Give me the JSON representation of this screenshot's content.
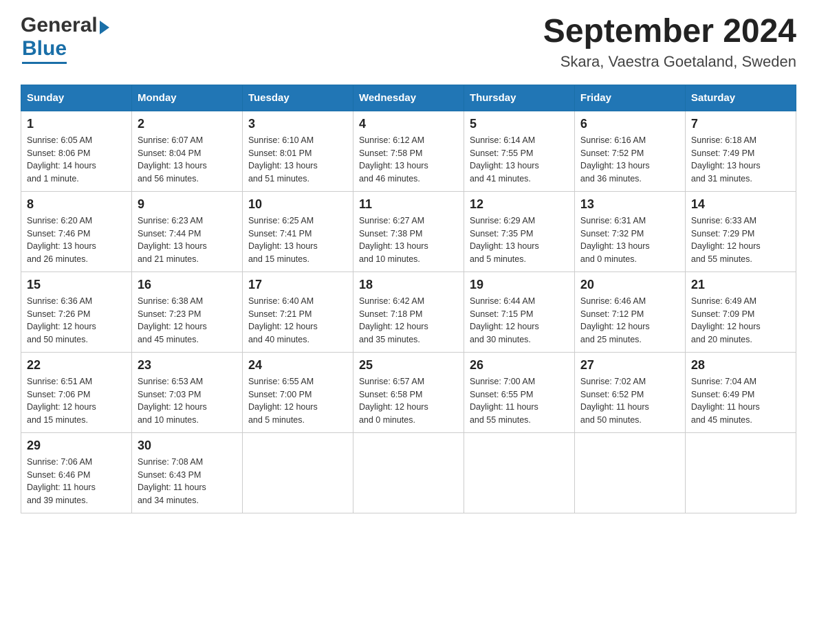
{
  "header": {
    "logo_general": "General",
    "logo_blue": "Blue",
    "month_year": "September 2024",
    "location": "Skara, Vaestra Goetaland, Sweden"
  },
  "weekdays": [
    "Sunday",
    "Monday",
    "Tuesday",
    "Wednesday",
    "Thursday",
    "Friday",
    "Saturday"
  ],
  "weeks": [
    [
      {
        "day": "1",
        "sunrise": "6:05 AM",
        "sunset": "8:06 PM",
        "daylight": "14 hours and 1 minute."
      },
      {
        "day": "2",
        "sunrise": "6:07 AM",
        "sunset": "8:04 PM",
        "daylight": "13 hours and 56 minutes."
      },
      {
        "day": "3",
        "sunrise": "6:10 AM",
        "sunset": "8:01 PM",
        "daylight": "13 hours and 51 minutes."
      },
      {
        "day": "4",
        "sunrise": "6:12 AM",
        "sunset": "7:58 PM",
        "daylight": "13 hours and 46 minutes."
      },
      {
        "day": "5",
        "sunrise": "6:14 AM",
        "sunset": "7:55 PM",
        "daylight": "13 hours and 41 minutes."
      },
      {
        "day": "6",
        "sunrise": "6:16 AM",
        "sunset": "7:52 PM",
        "daylight": "13 hours and 36 minutes."
      },
      {
        "day": "7",
        "sunrise": "6:18 AM",
        "sunset": "7:49 PM",
        "daylight": "13 hours and 31 minutes."
      }
    ],
    [
      {
        "day": "8",
        "sunrise": "6:20 AM",
        "sunset": "7:46 PM",
        "daylight": "13 hours and 26 minutes."
      },
      {
        "day": "9",
        "sunrise": "6:23 AM",
        "sunset": "7:44 PM",
        "daylight": "13 hours and 21 minutes."
      },
      {
        "day": "10",
        "sunrise": "6:25 AM",
        "sunset": "7:41 PM",
        "daylight": "13 hours and 15 minutes."
      },
      {
        "day": "11",
        "sunrise": "6:27 AM",
        "sunset": "7:38 PM",
        "daylight": "13 hours and 10 minutes."
      },
      {
        "day": "12",
        "sunrise": "6:29 AM",
        "sunset": "7:35 PM",
        "daylight": "13 hours and 5 minutes."
      },
      {
        "day": "13",
        "sunrise": "6:31 AM",
        "sunset": "7:32 PM",
        "daylight": "13 hours and 0 minutes."
      },
      {
        "day": "14",
        "sunrise": "6:33 AM",
        "sunset": "7:29 PM",
        "daylight": "12 hours and 55 minutes."
      }
    ],
    [
      {
        "day": "15",
        "sunrise": "6:36 AM",
        "sunset": "7:26 PM",
        "daylight": "12 hours and 50 minutes."
      },
      {
        "day": "16",
        "sunrise": "6:38 AM",
        "sunset": "7:23 PM",
        "daylight": "12 hours and 45 minutes."
      },
      {
        "day": "17",
        "sunrise": "6:40 AM",
        "sunset": "7:21 PM",
        "daylight": "12 hours and 40 minutes."
      },
      {
        "day": "18",
        "sunrise": "6:42 AM",
        "sunset": "7:18 PM",
        "daylight": "12 hours and 35 minutes."
      },
      {
        "day": "19",
        "sunrise": "6:44 AM",
        "sunset": "7:15 PM",
        "daylight": "12 hours and 30 minutes."
      },
      {
        "day": "20",
        "sunrise": "6:46 AM",
        "sunset": "7:12 PM",
        "daylight": "12 hours and 25 minutes."
      },
      {
        "day": "21",
        "sunrise": "6:49 AM",
        "sunset": "7:09 PM",
        "daylight": "12 hours and 20 minutes."
      }
    ],
    [
      {
        "day": "22",
        "sunrise": "6:51 AM",
        "sunset": "7:06 PM",
        "daylight": "12 hours and 15 minutes."
      },
      {
        "day": "23",
        "sunrise": "6:53 AM",
        "sunset": "7:03 PM",
        "daylight": "12 hours and 10 minutes."
      },
      {
        "day": "24",
        "sunrise": "6:55 AM",
        "sunset": "7:00 PM",
        "daylight": "12 hours and 5 minutes."
      },
      {
        "day": "25",
        "sunrise": "6:57 AM",
        "sunset": "6:58 PM",
        "daylight": "12 hours and 0 minutes."
      },
      {
        "day": "26",
        "sunrise": "7:00 AM",
        "sunset": "6:55 PM",
        "daylight": "11 hours and 55 minutes."
      },
      {
        "day": "27",
        "sunrise": "7:02 AM",
        "sunset": "6:52 PM",
        "daylight": "11 hours and 50 minutes."
      },
      {
        "day": "28",
        "sunrise": "7:04 AM",
        "sunset": "6:49 PM",
        "daylight": "11 hours and 45 minutes."
      }
    ],
    [
      {
        "day": "29",
        "sunrise": "7:06 AM",
        "sunset": "6:46 PM",
        "daylight": "11 hours and 39 minutes."
      },
      {
        "day": "30",
        "sunrise": "7:08 AM",
        "sunset": "6:43 PM",
        "daylight": "11 hours and 34 minutes."
      },
      null,
      null,
      null,
      null,
      null
    ]
  ],
  "labels": {
    "sunrise": "Sunrise:",
    "sunset": "Sunset:",
    "daylight": "Daylight:"
  }
}
